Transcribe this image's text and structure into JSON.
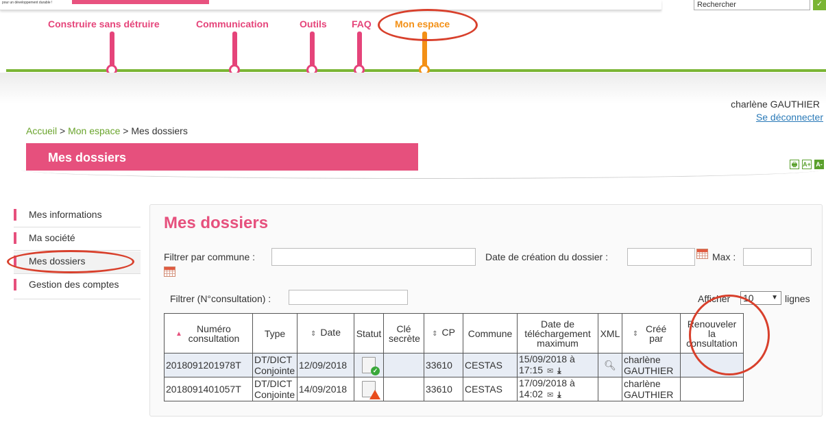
{
  "header": {
    "tagline": "pour un développement durable !",
    "search_placeholder": "Rechercher",
    "search_go": "✓"
  },
  "nav": [
    {
      "label": "Construire sans détruire",
      "active": false
    },
    {
      "label": "Communication",
      "active": false
    },
    {
      "label": "Outils",
      "active": false
    },
    {
      "label": "FAQ",
      "active": false
    },
    {
      "label": "Mon espace",
      "active": true
    }
  ],
  "user": {
    "name": "charlène GAUTHIER",
    "logout": "Se déconnecter"
  },
  "breadcrumb": {
    "home": "Accueil",
    "sep1": " > ",
    "space": "Mon espace",
    "sep2": " > ",
    "current": "Mes dossiers"
  },
  "page_banner": "Mes dossiers",
  "tools": {
    "print": "🖶",
    "font_up": "A+",
    "font_down": "A-"
  },
  "sidebar": [
    {
      "label": "Mes informations"
    },
    {
      "label": "Ma société"
    },
    {
      "label": "Mes dossiers",
      "selected": true
    },
    {
      "label": "Gestion des comptes"
    }
  ],
  "main": {
    "title": "Mes dossiers",
    "filter_commune_label": "Filtrer par commune :",
    "filter_commune_value": "",
    "date_creation_label": "Date de création du dossier :",
    "max_label": "Max :",
    "filter_consult_label": "Filtrer (N°consultation) :",
    "show_label": "Afficher",
    "rows_value": "10",
    "lines_label": "lignes"
  },
  "table": {
    "headers": {
      "num": "Numéro consultation",
      "type": "Type",
      "date": "Date",
      "statut": "Statut",
      "cle": "Clé secrète",
      "cp": "CP",
      "commune": "Commune",
      "date_dl": "Date de téléchargement maximum",
      "xml": "XML",
      "cree": "Créé par",
      "renew": "Renouveler la consultation"
    },
    "rows": [
      {
        "num": "2018091201978T",
        "type": "DT/DICT Conjointe",
        "date": "12/09/2018",
        "statut": "ok",
        "cle": "",
        "cp": "33610",
        "commune": "CESTAS",
        "dl_date": "15/09/2018 à",
        "dl_time": "17:15",
        "xml": "search",
        "cree": "charlène GAUTHIER",
        "renew": ""
      },
      {
        "num": "2018091401057T",
        "type": "DT/DICT Conjointe",
        "date": "14/09/2018",
        "statut": "warning",
        "cle": "",
        "cp": "33610",
        "commune": "CESTAS",
        "dl_date": "17/09/2018 à",
        "dl_time": "14:02",
        "xml": "",
        "cree": "charlène GAUTHIER",
        "renew": ""
      }
    ]
  },
  "colors": {
    "pink": "#e6507d",
    "orange": "#f39016",
    "green": "#7ab534",
    "annotation_red": "#d8402c"
  }
}
